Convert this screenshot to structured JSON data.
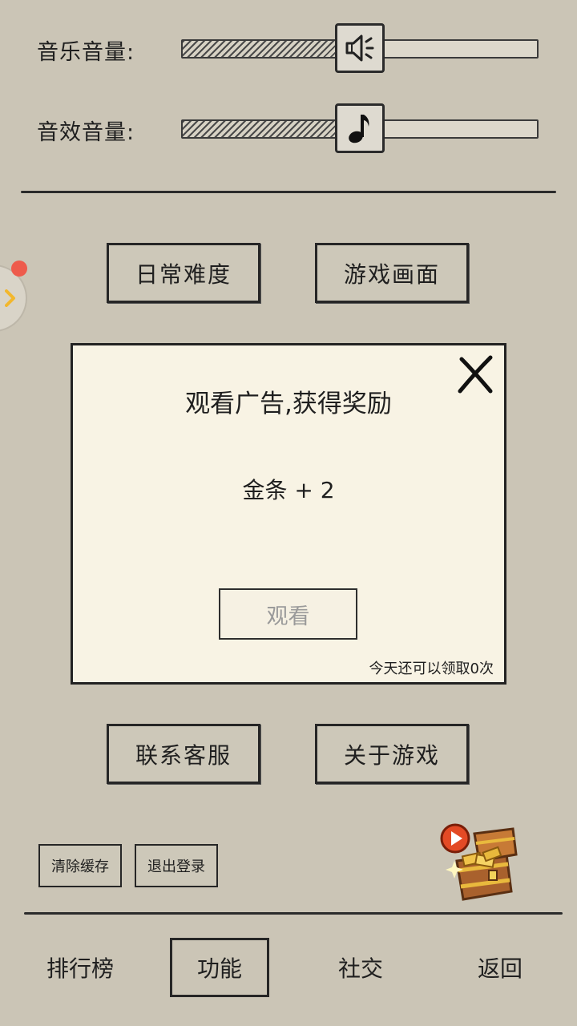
{
  "settings": {
    "music_label": "音乐音量:",
    "music_level": 0.43,
    "sfx_label": "音效音量:",
    "sfx_level": 0.43
  },
  "buttons": {
    "difficulty": "日常难度",
    "graphics": "游戏画面",
    "contact": "联系客服",
    "about": "关于游戏",
    "clear_cache": "清除缓存",
    "logout": "退出登录"
  },
  "dialog": {
    "title": "观看广告,获得奖励",
    "reward": "金条 + 2",
    "watch_label": "观看",
    "remaining": "今天还可以领取0次"
  },
  "nav": {
    "leaderboard": "排行榜",
    "functions": "功能",
    "social": "社交",
    "back": "返回"
  },
  "icons": {
    "music_knob": "speaker-icon",
    "sfx_knob": "music-note-icon",
    "close": "close-icon",
    "treasure": "treasure-chest-icon",
    "side_arrow": "chevron-right-icon"
  },
  "colors": {
    "background": "#cbc5b6",
    "dialog": "#f8f3e4",
    "notification_dot": "#ee5b4c",
    "side_arrow": "#f2b72d"
  }
}
